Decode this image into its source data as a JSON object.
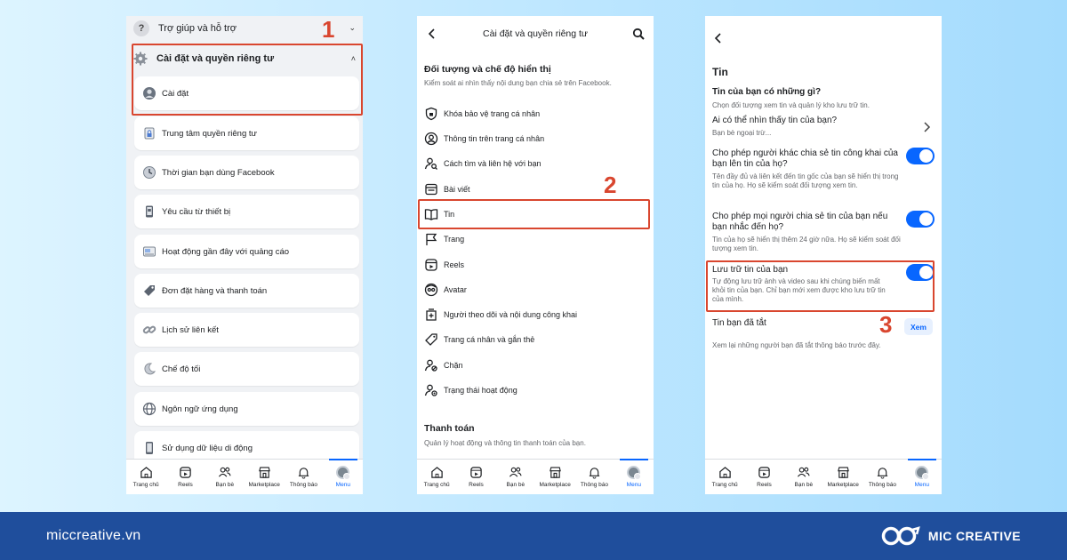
{
  "phone1": {
    "help_label": "Trợ giúp và hỗ trợ",
    "settings_privacy_label": "Cài đặt và quyền riêng tư",
    "items": [
      {
        "label": "Cài đặt",
        "icon": "user-circle-icon"
      },
      {
        "label": "Trung tâm quyền riêng tư",
        "icon": "lock-icon"
      },
      {
        "label": "Thời gian bạn dùng Facebook",
        "icon": "clock-icon"
      },
      {
        "label": "Yêu cầu từ thiết bị",
        "icon": "device-icon"
      },
      {
        "label": "Hoạt động gần đây với quảng cáo",
        "icon": "ad-icon"
      },
      {
        "label": "Đơn đặt hàng và thanh toán",
        "icon": "tag-icon"
      },
      {
        "label": "Lịch sử liên kết",
        "icon": "link-icon"
      },
      {
        "label": "Chế độ tối",
        "icon": "moon-icon"
      },
      {
        "label": "Ngôn ngữ ứng dụng",
        "icon": "globe-icon"
      },
      {
        "label": "Sử dụng dữ liệu di động",
        "icon": "phone-icon"
      }
    ]
  },
  "phone2": {
    "title": "Cài đặt và quyền riêng tư",
    "section1_title": "Đối tượng và chế độ hiển thị",
    "section1_desc": "Kiểm soát ai nhìn thấy nội dung bạn chia sẻ trên Facebook.",
    "items": [
      {
        "label": "Khóa bảo vệ trang cá nhân",
        "icon": "shield-icon"
      },
      {
        "label": "Thông tin trên trang cá nhân",
        "icon": "user-circle-icon"
      },
      {
        "label": "Cách tìm và liên hệ với bạn",
        "icon": "user-search-icon"
      },
      {
        "label": "Bài viết",
        "icon": "post-icon"
      },
      {
        "label": "Tin",
        "icon": "book-icon"
      },
      {
        "label": "Trang",
        "icon": "flag-icon"
      },
      {
        "label": "Reels",
        "icon": "reels-icon"
      },
      {
        "label": "Avatar",
        "icon": "avatar-icon"
      },
      {
        "label": "Người theo dõi và nội dung công khai",
        "icon": "followers-icon"
      },
      {
        "label": "Trang cá nhân và gắn thẻ",
        "icon": "tag-icon"
      },
      {
        "label": "Chặn",
        "icon": "block-user-icon"
      },
      {
        "label": "Trạng thái hoạt động",
        "icon": "activity-user-icon"
      }
    ],
    "section2_title": "Thanh toán",
    "section2_desc": "Quản lý hoạt động và thông tin thanh toán của bạn."
  },
  "phone3": {
    "heading": "Tin",
    "q_title": "Tin của bạn có những gì?",
    "q_desc": "Chọn đối tượng xem tin và quản lý kho lưu trữ tin.",
    "who_title": "Ai có thể nhìn thấy tin của bạn?",
    "who_desc": "Bạn bè ngoại trừ...",
    "allow_share_title": "Cho phép người khác chia sẻ tin công khai của bạn lên tin của họ?",
    "allow_share_desc": "Tên đầy đủ và liên kết đến tin gốc của bạn sẽ hiển thị trong tin của họ. Họ sẽ kiểm soát đối tượng xem tin.",
    "allow_mention_title": "Cho phép mọi người chia sẻ tin của bạn nếu bạn nhắc đến họ?",
    "allow_mention_desc": "Tin của họ sẽ hiển thị thêm 24 giờ nữa. Họ sẽ kiểm soát đối tượng xem tin.",
    "archive_title": "Lưu trữ tin của bạn",
    "archive_desc": "Tự động lưu trữ ảnh và video sau khi chúng biến mất khỏi tin của bạn. Chỉ bạn mới xem được kho lưu trữ tin của mình.",
    "muted_title": "Tin bạn đã tắt",
    "muted_desc": "Xem lại những người bạn đã tắt thông báo trước đây.",
    "xem_label": "Xem"
  },
  "nav": {
    "items": [
      {
        "label": "Trang chủ",
        "icon": "home-icon"
      },
      {
        "label": "Reels",
        "icon": "reels-icon"
      },
      {
        "label": "Bạn bè",
        "icon": "friends-icon"
      },
      {
        "label": "Marketplace",
        "icon": "marketplace-icon"
      },
      {
        "label": "Thông báo",
        "icon": "bell-icon"
      },
      {
        "label": "Menu",
        "icon": "avatar"
      }
    ]
  },
  "steps": {
    "one": "1",
    "two": "2",
    "three": "3"
  },
  "footer": {
    "site": "miccreative.vn",
    "brand": "MIC CREATIVE"
  },
  "colors": {
    "accent": "#0866ff",
    "highlight": "#d9462f",
    "footer": "#1f4e9c"
  }
}
